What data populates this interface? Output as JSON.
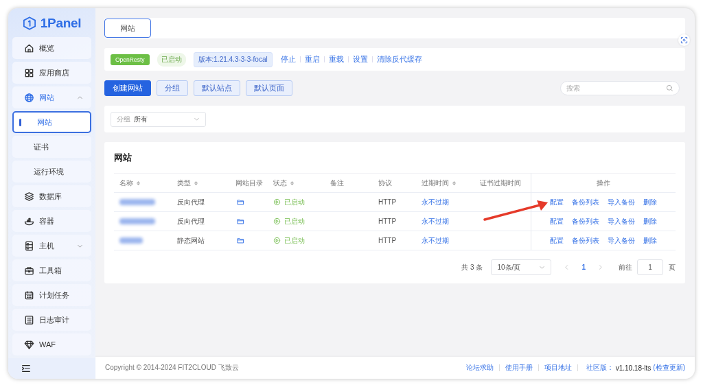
{
  "sidebar": {
    "logo": "1Panel",
    "items": [
      {
        "label": "概览",
        "selected": false
      },
      {
        "label": "应用商店",
        "selected": false
      },
      {
        "label": "网站",
        "selected": true,
        "expanded": true,
        "children": [
          {
            "label": "网站",
            "selected": true
          },
          {
            "label": "证书",
            "selected": false
          },
          {
            "label": "运行环境",
            "selected": false
          }
        ]
      },
      {
        "label": "数据库",
        "selected": false
      },
      {
        "label": "容器",
        "selected": false
      },
      {
        "label": "主机",
        "selected": false,
        "expanded": false
      },
      {
        "label": "工具箱",
        "selected": false
      },
      {
        "label": "计划任务",
        "selected": false
      },
      {
        "label": "日志审计",
        "selected": false
      },
      {
        "label": "WAF",
        "selected": false
      }
    ]
  },
  "header_tabs": [
    {
      "label": "网站",
      "selected": true
    }
  ],
  "server_bar": {
    "app": "OpenResty",
    "status": "已启动",
    "version": "版本:1.21.4.3-3-3-focal",
    "actions": [
      "停止",
      "重启",
      "重载",
      "设置",
      "清除反代缓存"
    ]
  },
  "toolbar": {
    "buttons": [
      {
        "label": "创建网站",
        "kind": "primary"
      },
      {
        "label": "分组",
        "kind": "plain"
      },
      {
        "label": "默认站点",
        "kind": "plain"
      },
      {
        "label": "默认页面",
        "kind": "plain"
      }
    ],
    "search": {
      "placeholder": "搜索"
    }
  },
  "filter": {
    "label": "分组",
    "value": "所有"
  },
  "table": {
    "title": "网站",
    "columns": [
      {
        "label": "名称",
        "sortable": true
      },
      {
        "label": "类型",
        "sortable": true
      },
      {
        "label": "网站目录",
        "sortable": false
      },
      {
        "label": "状态",
        "sortable": true
      },
      {
        "label": "备注",
        "sortable": false
      },
      {
        "label": "协议",
        "sortable": false
      },
      {
        "label": "过期时间",
        "sortable": true
      },
      {
        "label": "证书过期时间",
        "sortable": false
      },
      {
        "label": "操作",
        "sortable": false
      }
    ],
    "rows": [
      {
        "type": "反向代理",
        "status": "已启动",
        "protocol": "HTTP",
        "expiry": "永不过期",
        "actions": [
          "配置",
          "备份列表",
          "导入备份",
          "删除"
        ]
      },
      {
        "type": "反向代理",
        "status": "已启动",
        "protocol": "HTTP",
        "expiry": "永不过期",
        "actions": [
          "配置",
          "备份列表",
          "导入备份",
          "删除"
        ]
      },
      {
        "type": "静态网站",
        "status": "已启动",
        "protocol": "HTTP",
        "expiry": "永不过期",
        "actions": [
          "配置",
          "备份列表",
          "导入备份",
          "删除"
        ]
      }
    ]
  },
  "pagination": {
    "total": "共 3 条",
    "page_size": "10条/页",
    "pages": [
      {
        "label": "1",
        "selected": true
      }
    ],
    "goto_label": "前往",
    "goto_value": "1",
    "goto_suffix": "页"
  },
  "footer": {
    "copyright": "Copyright © 2014-2024 FIT2CLOUD 飞致云",
    "links": [
      "论坛求助",
      "使用手册",
      "项目地址"
    ],
    "edition": "社区版：",
    "version": "v1.10.18-lts",
    "update": "(检查更新)"
  }
}
